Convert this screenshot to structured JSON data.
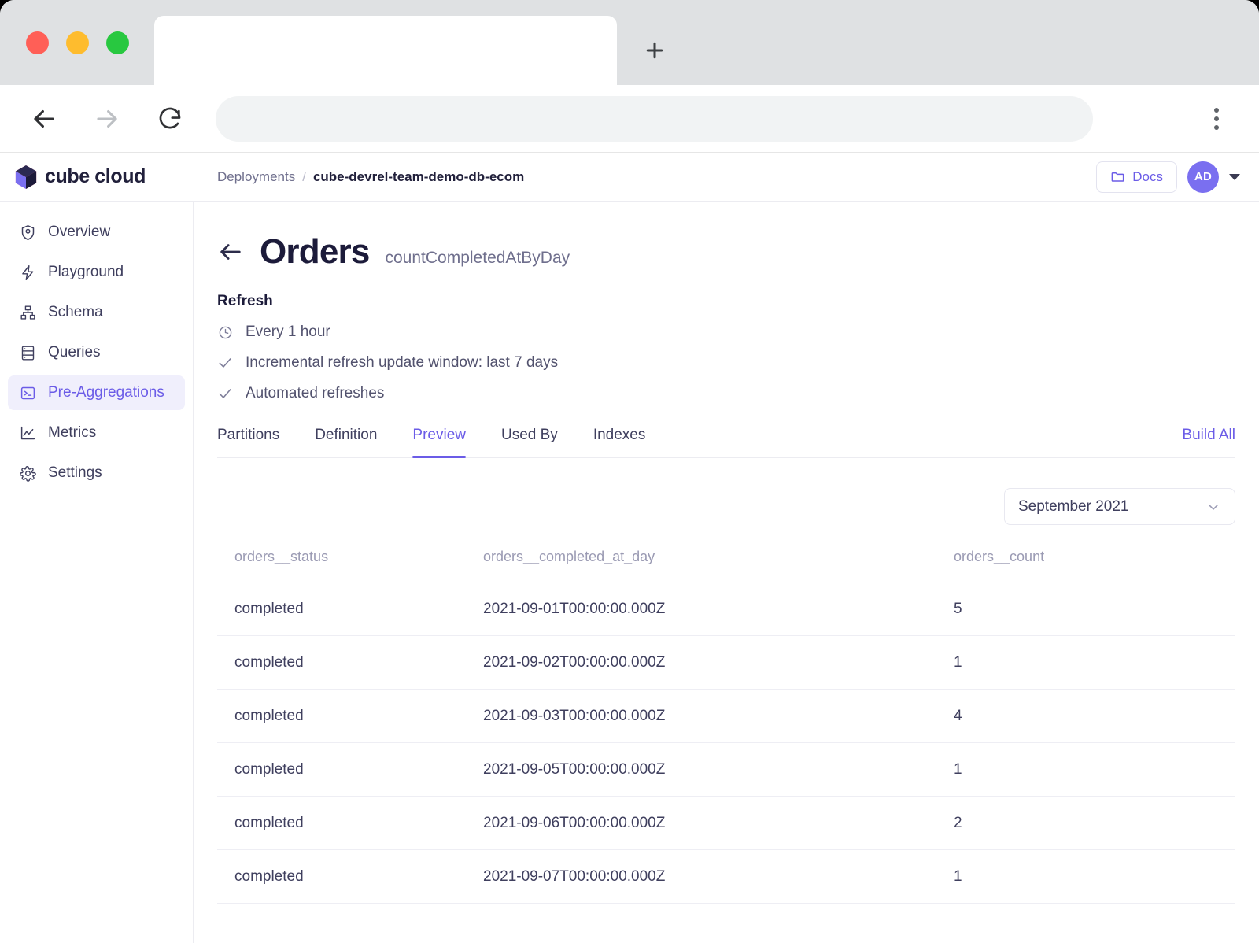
{
  "browser": {
    "traffic_lights": [
      "close",
      "minimize",
      "maximize"
    ],
    "tab_title": "",
    "new_tab_label": "+",
    "address_value": "",
    "address_placeholder": "",
    "back_label": "Back",
    "forward_label": "Forward",
    "reload_label": "Reload",
    "menu_label": "Menu"
  },
  "header": {
    "logo_text": "cube cloud",
    "breadcrumb": {
      "root": "Deployments",
      "separator": "/",
      "current": "cube-devrel-team-demo-db-ecom"
    },
    "docs_label": "Docs",
    "avatar_initials": "AD"
  },
  "sidebar": {
    "items": [
      {
        "label": "Overview",
        "icon": "overview-icon",
        "active": false
      },
      {
        "label": "Playground",
        "icon": "playground-icon",
        "active": false
      },
      {
        "label": "Schema",
        "icon": "schema-icon",
        "active": false
      },
      {
        "label": "Queries",
        "icon": "queries-icon",
        "active": false
      },
      {
        "label": "Pre-Aggregations",
        "icon": "terminal-icon",
        "active": true
      },
      {
        "label": "Metrics",
        "icon": "metrics-icon",
        "active": false
      },
      {
        "label": "Settings",
        "icon": "gear-icon",
        "active": false
      }
    ]
  },
  "main": {
    "title": "Orders",
    "subtitle": "countCompletedAtByDay",
    "refresh": {
      "heading": "Refresh",
      "lines": [
        {
          "icon": "clock-icon",
          "text": "Every 1 hour"
        },
        {
          "icon": "check-icon",
          "text": "Incremental refresh update window: last 7 days"
        },
        {
          "icon": "check-icon",
          "text": "Automated refreshes"
        }
      ]
    },
    "tabs": [
      {
        "label": "Partitions",
        "active": false
      },
      {
        "label": "Definition",
        "active": false
      },
      {
        "label": "Preview",
        "active": true
      },
      {
        "label": "Used By",
        "active": false
      },
      {
        "label": "Indexes",
        "active": false
      }
    ],
    "build_all_label": "Build All",
    "month_select": {
      "value": "September 2021",
      "options": [
        "September 2021"
      ]
    },
    "table": {
      "columns": [
        "orders__status",
        "orders__completed_at_day",
        "orders__count"
      ],
      "rows": [
        [
          "completed",
          "2021-09-01T00:00:00.000Z",
          "5"
        ],
        [
          "completed",
          "2021-09-02T00:00:00.000Z",
          "1"
        ],
        [
          "completed",
          "2021-09-03T00:00:00.000Z",
          "4"
        ],
        [
          "completed",
          "2021-09-05T00:00:00.000Z",
          "1"
        ],
        [
          "completed",
          "2021-09-06T00:00:00.000Z",
          "2"
        ],
        [
          "completed",
          "2021-09-07T00:00:00.000Z",
          "1"
        ]
      ]
    }
  },
  "colors": {
    "accent": "#6b5ce7",
    "title": "#1c1b3a",
    "muted": "#6f6f8d",
    "active_bg": "#f0effc",
    "border": "#ececf1"
  }
}
